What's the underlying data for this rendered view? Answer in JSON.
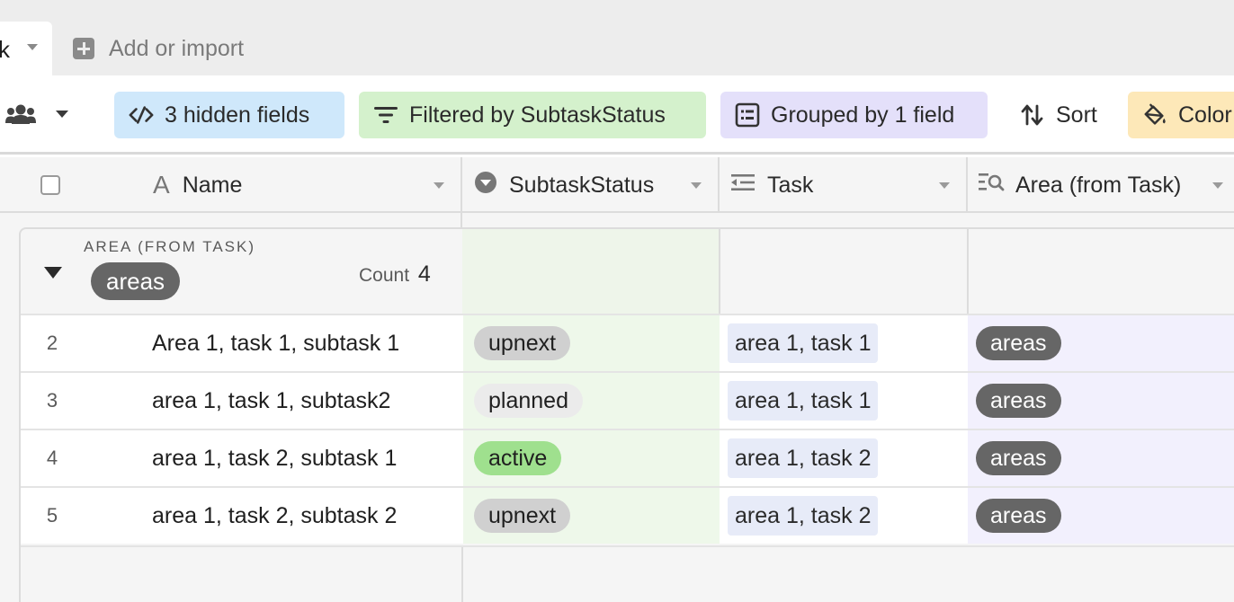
{
  "tabbar": {
    "active_tab_label": "k",
    "add_label": "Add or import"
  },
  "viewbar": {
    "hidden_fields": "3 hidden fields",
    "filter": "Filtered by SubtaskStatus",
    "group": "Grouped by 1 field",
    "sort": "Sort",
    "color": "Color"
  },
  "columns": {
    "name": "Name",
    "status": "SubtaskStatus",
    "task": "Task",
    "area": "Area (from Task)"
  },
  "group": {
    "label": "AREA (FROM TASK)",
    "value": "areas",
    "count_label": "Count",
    "count_value": "4"
  },
  "rows": [
    {
      "num": "2",
      "name": "Area 1, task 1, subtask 1",
      "status": "upnext",
      "task": "area 1, task 1",
      "area": "areas"
    },
    {
      "num": "3",
      "name": "area 1, task 1, subtask2",
      "status": "planned",
      "task": "area 1, task 1",
      "area": "areas"
    },
    {
      "num": "4",
      "name": "area 1, task 2, subtask 1",
      "status": "active",
      "task": "area 1, task 2",
      "area": "areas"
    },
    {
      "num": "5",
      "name": "area 1, task 2, subtask 2",
      "status": "upnext",
      "task": "area 1, task 2",
      "area": "areas"
    }
  ],
  "colors": {
    "hidden_bg": "#cfe8fb",
    "filter_bg": "#d4f1cc",
    "group_bg": "#e4e0fa",
    "color_bg": "#fde8b8",
    "status_active": "#9fe08e",
    "status_upnext": "#d0d0d0",
    "status_planned": "#ebebeb",
    "area_pill": "#666666"
  }
}
